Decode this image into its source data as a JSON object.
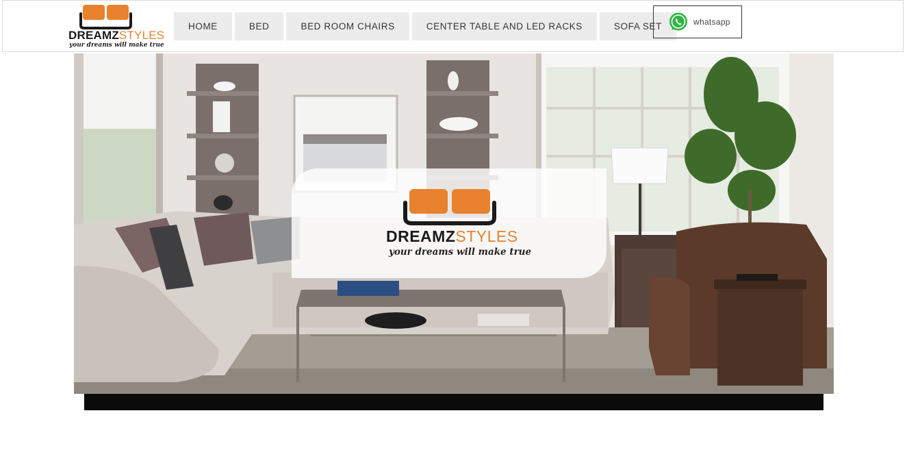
{
  "brand": {
    "name_part1": "DREAMZ",
    "name_part2": "STYLES",
    "tagline": "your dreams will make true",
    "accent_color": "#e8822e"
  },
  "nav": {
    "items": [
      {
        "label": "HOME"
      },
      {
        "label": "BED"
      },
      {
        "label": "BED ROOM CHAIRS"
      },
      {
        "label": "CENTER TABLE AND LED RACKS"
      },
      {
        "label": "SOFA SET"
      }
    ]
  },
  "whatsapp": {
    "label": "whatsapp",
    "icon": "whatsapp-icon",
    "color": "#2fb543"
  },
  "hero": {
    "overlay_brand_part1": "DREAMZ",
    "overlay_brand_part2": "STYLES",
    "overlay_tagline": "your dreams will make true"
  }
}
